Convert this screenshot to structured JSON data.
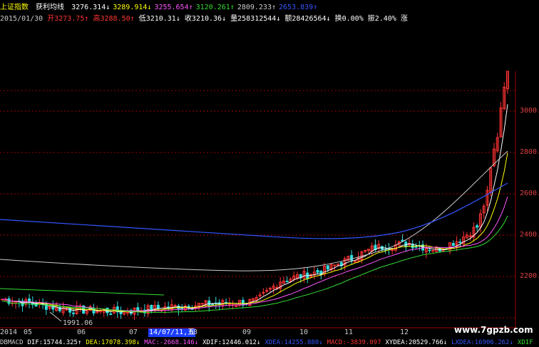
{
  "header": {
    "index_name": "上证指数",
    "indicator_name": "获利均线",
    "ma_values": [
      {
        "text": "3276.314",
        "arrow": "↓",
        "color": "#ffffff"
      },
      {
        "text": "3289.914",
        "arrow": "↓",
        "color": "#ffff00"
      },
      {
        "text": "3255.654",
        "arrow": "↑",
        "color": "#ff55ff"
      },
      {
        "text": "3120.261",
        "arrow": "↑",
        "color": "#33dd33"
      },
      {
        "text": "2809.233",
        "arrow": "↑",
        "color": "#cccccc"
      },
      {
        "text": "2653.839",
        "arrow": "↑",
        "color": "#3355ff"
      }
    ]
  },
  "quote": {
    "date": "2015/01/30",
    "open_label": "开",
    "open": "3273.75",
    "open_arrow": "↑",
    "high_label": "高",
    "high": "3288.50",
    "high_arrow": "↑",
    "low_label": "低",
    "low": "3210.31",
    "low_arrow": "↓",
    "close_label": "收",
    "close": "3210.36",
    "close_arrow": "↓",
    "volume_label": "量",
    "volume": "258312544",
    "volume_arrow": "↓",
    "amount_label": "额",
    "amount": "28426564",
    "amount_arrow": "↓",
    "turnover_label": "换",
    "turnover": "0.00%",
    "amplitude_label": "振",
    "amplitude": "2.40%",
    "change_label": "涨"
  },
  "y_axis": {
    "labels": [
      "3000.0",
      "2800.0",
      "2600.0",
      "2400.0",
      "2200.0"
    ],
    "label_color": "#e04040"
  },
  "x_axis": {
    "labels": [
      "2014",
      "05",
      "06",
      "07",
      "14/07/11,五",
      "08",
      "09",
      "10",
      "11",
      "12"
    ],
    "cursor_label": "14/07/11,五"
  },
  "annotation": "1991.06",
  "watermark": "www.7gpzb.com",
  "footer": {
    "items": [
      {
        "text": "DBMACD",
        "color": "#cccccc"
      },
      {
        "text": "DIF:15744.325↑",
        "color": "#ffffff"
      },
      {
        "text": "DEA:17078.398↓",
        "color": "#ffff00"
      },
      {
        "text": "MAC:-2668.146↓",
        "color": "#ff55ff"
      },
      {
        "text": "XDIF:12446.012↓",
        "color": "#ffffff"
      },
      {
        "text": "XDEA:14255.880↓",
        "color": "#3355ff"
      },
      {
        "text": "MACD:-3839.097",
        "color": "#ff3333"
      },
      {
        "text": "XYDEA:20529.766↓",
        "color": "#ffffff"
      },
      {
        "text": "LXDEA:16906.262↓",
        "color": "#3355ff"
      },
      {
        "text": "XDIF",
        "color": "#33dd33"
      }
    ]
  },
  "colors": {
    "up_candle": "#ff3333",
    "down_candle": "#33dddd",
    "grid": "#a00000",
    "ma5": "#ffffff",
    "ma10": "#ffff00",
    "ma20": "#ff55ff",
    "ma30": "#33dd33",
    "ma60": "#cccccc",
    "ma120": "#3355ff"
  }
}
